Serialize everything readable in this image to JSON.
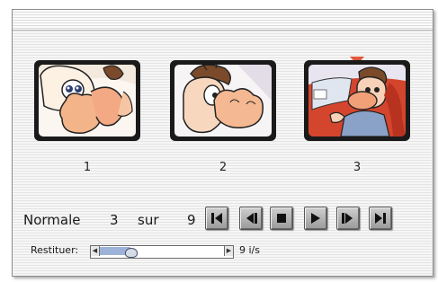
{
  "frames": [
    {
      "number": "1"
    },
    {
      "number": "2"
    },
    {
      "number": "3"
    }
  ],
  "selected_frame_index": 3,
  "playback": {
    "mode_label": "Normale",
    "current_frame": "3",
    "separator": "sur",
    "total_frames": "9"
  },
  "controls": {
    "icons": [
      "skip-to-start-icon",
      "step-back-icon",
      "stop-icon",
      "play-icon",
      "step-forward-icon",
      "skip-to-end-icon"
    ]
  },
  "speed": {
    "label": "Restituer:",
    "value_text": "9 i/s",
    "slider_fraction": 0.25,
    "left_arrow": "◀",
    "right_arrow": "▶"
  },
  "colors": {
    "marker": "#e0573a",
    "slider_fill": "#9db2d8",
    "frame_border": "#1a1a1a"
  }
}
